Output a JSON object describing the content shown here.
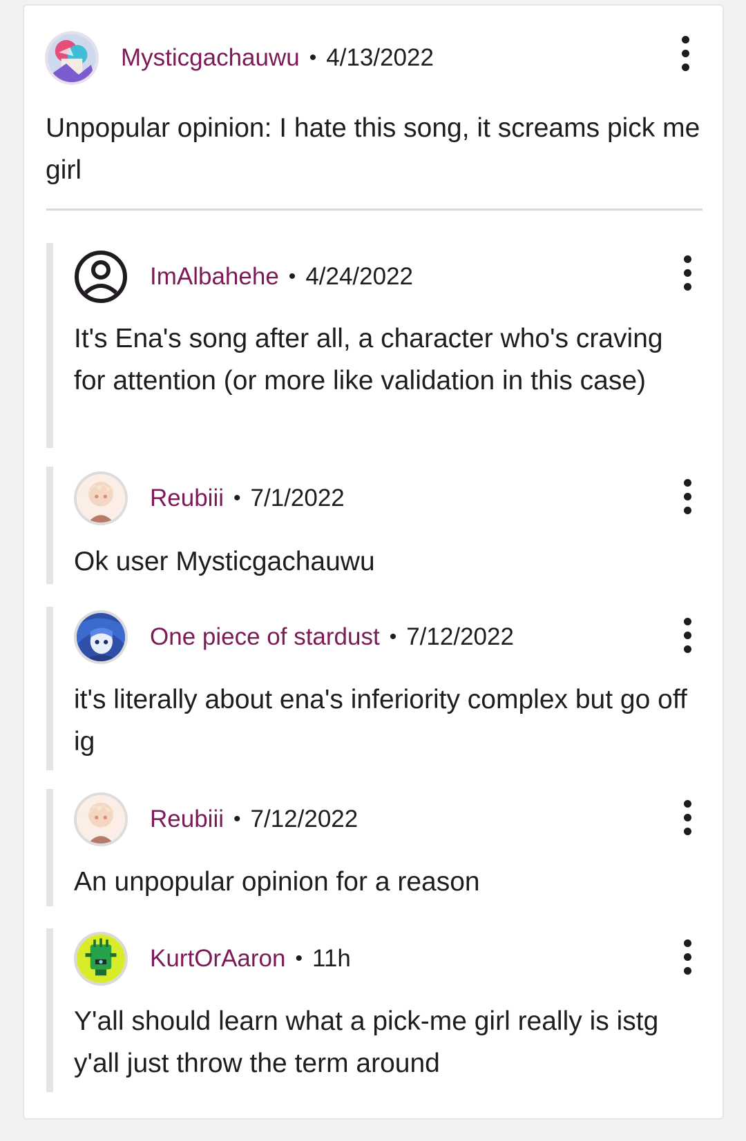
{
  "main_comment": {
    "username": "Mysticgachauwu",
    "separator": "•",
    "date": "4/13/2022",
    "text": "Unpopular opinion: I hate this song, it screams pick me girl",
    "avatar_icon": "anime-avatar"
  },
  "replies": [
    {
      "username": "ImAlbahehe",
      "separator": "•",
      "date": "4/24/2022",
      "text": "It's Ena's song after all, a character who's craving for attention (or more like validation in this case)",
      "avatar_icon": "default-user-icon"
    },
    {
      "username": "Reubiii",
      "separator": "•",
      "date": "7/1/2022",
      "text": "Ok user Mysticgachauwu",
      "avatar_icon": "anime-avatar"
    },
    {
      "username": "One piece of stardust",
      "separator": "•",
      "date": "7/12/2022",
      "text": "it's literally about ena's inferiority complex but go off ig",
      "avatar_icon": "anime-avatar"
    },
    {
      "username": "Reubiii",
      "separator": "•",
      "date": "7/12/2022",
      "text": "An unpopular opinion for a reason",
      "avatar_icon": "anime-avatar"
    },
    {
      "username": "KurtOrAaron",
      "separator": "•",
      "date": "11h",
      "text": "Y'all should learn what a pick-me girl really is istg y'all just throw the term around",
      "avatar_icon": "robot-avatar"
    }
  ],
  "colors": {
    "username": "#7b1a57",
    "text": "#1f1b20",
    "thread_bar": "#e5e5e5",
    "divider": "#d8d8d8"
  }
}
